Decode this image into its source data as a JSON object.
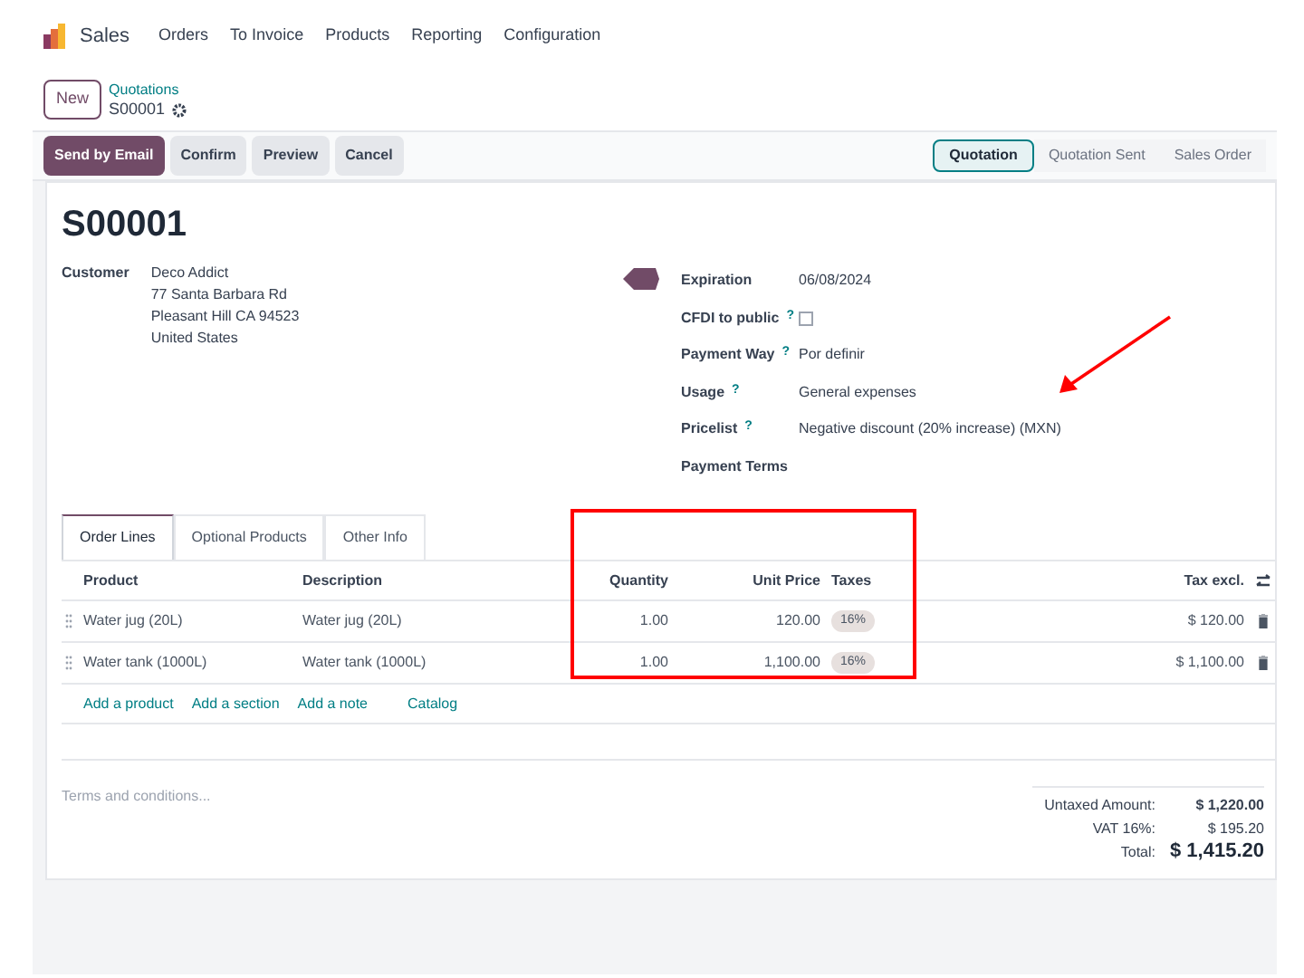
{
  "nav": {
    "app": "Sales",
    "menu": [
      "Orders",
      "To Invoice",
      "Products",
      "Reporting",
      "Configuration"
    ]
  },
  "breadcrumb": {
    "new_button": "New",
    "parent": "Quotations",
    "current": "S00001"
  },
  "actions": [
    {
      "label": "Send by Email",
      "kind": "primary"
    },
    {
      "label": "Confirm",
      "kind": "secondary"
    },
    {
      "label": "Preview",
      "kind": "secondary"
    },
    {
      "label": "Cancel",
      "kind": "secondary"
    }
  ],
  "stages": [
    {
      "label": "Quotation",
      "selected": true
    },
    {
      "label": "Quotation Sent",
      "selected": false
    },
    {
      "label": "Sales Order",
      "selected": false
    }
  ],
  "title": "S00001",
  "customer": {
    "label": "Customer",
    "lines": [
      "Deco Addict",
      "77 Santa Barbara Rd",
      "Pleasant Hill CA 94523",
      "United States"
    ]
  },
  "fields": [
    {
      "label": "Expiration",
      "kind": "text",
      "value": "06/08/2024"
    },
    {
      "label": "CFDI to public",
      "kind": "checkbox",
      "checked": false,
      "help": "?"
    },
    {
      "label": "Payment Way",
      "kind": "text",
      "value": "Por definir",
      "help": "?"
    },
    {
      "label": "Usage",
      "kind": "text",
      "value": "General expenses",
      "help": "?"
    },
    {
      "label": "Pricelist",
      "kind": "text",
      "value": "Negative discount (20% increase) (MXN)",
      "help": "?"
    },
    {
      "label": "Payment Terms",
      "kind": "text"
    }
  ],
  "tabs": [
    {
      "label": "Order Lines",
      "selected": true
    },
    {
      "label": "Optional Products",
      "selected": false
    },
    {
      "label": "Other Info",
      "selected": false
    }
  ],
  "table": {
    "columns": [
      "Product",
      "Description",
      "Quantity",
      "Unit Price",
      "Taxes",
      "Tax excl."
    ],
    "rows": [
      {
        "product": "Water jug (20L)",
        "description": "Water jug (20L)",
        "quantity": "1.00",
        "unit_price": "120.00",
        "tax": "16%",
        "subtotal": "$ 120.00"
      },
      {
        "product": "Water tank (1000L)",
        "description": "Water tank (1000L)",
        "quantity": "1.00",
        "unit_price": "1,100.00",
        "tax": "16%",
        "subtotal": "$ 1,100.00"
      }
    ],
    "links": [
      "Add a product",
      "Add a section",
      "Add a note",
      "Catalog"
    ]
  },
  "terms": {
    "placeholder": "Terms and conditions..."
  },
  "totals": [
    {
      "label": "Untaxed Amount:",
      "value": "$ 1,220.00",
      "kind": "bold"
    },
    {
      "label": "VAT 16%:",
      "value": "$ 195.20",
      "kind": "normal"
    },
    {
      "label": "Total:",
      "value": "$ 1,415.20",
      "kind": "grand"
    }
  ]
}
